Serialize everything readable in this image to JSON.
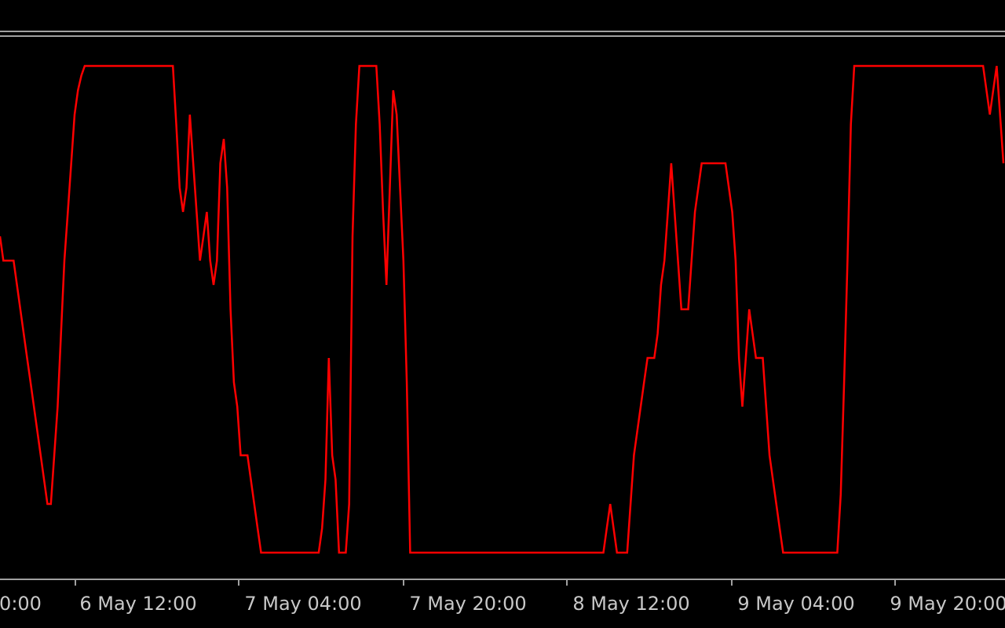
{
  "chart_data": {
    "type": "line",
    "title": "",
    "xlabel": "",
    "ylabel": "",
    "ylim": [
      0,
      100
    ],
    "grid": false,
    "legend": "none",
    "colors": {
      "background": "#000000",
      "series": "#ff0000",
      "frame": "#a0a0a0",
      "text": "#c8c8c8"
    },
    "x_ticks": [
      "0:00",
      "6 May 12:00",
      "7 May 04:00",
      "7 May 20:00",
      "8 May 12:00",
      "9 May 04:00",
      "9 May 20:00"
    ],
    "series": [
      {
        "values": [
          65,
          60,
          60,
          60,
          60,
          55,
          50,
          45,
          40,
          35,
          30,
          25,
          20,
          15,
          10,
          10,
          20,
          30,
          45,
          60,
          70,
          80,
          90,
          95,
          98,
          100,
          100,
          100,
          100,
          100,
          100,
          100,
          100,
          100,
          100,
          100,
          100,
          100,
          100,
          100,
          100,
          100,
          100,
          100,
          100,
          100,
          100,
          100,
          100,
          100,
          100,
          100,
          88,
          75,
          70,
          75,
          90,
          80,
          70,
          60,
          65,
          70,
          60,
          55,
          60,
          80,
          85,
          75,
          50,
          35,
          30,
          20,
          20,
          20,
          15,
          10,
          5,
          0,
          0,
          0,
          0,
          0,
          0,
          0,
          0,
          0,
          0,
          0,
          0,
          0,
          0,
          0,
          0,
          0,
          0,
          5,
          15,
          40,
          20,
          15,
          0,
          0,
          0,
          10,
          65,
          88,
          100,
          100,
          100,
          100,
          100,
          100,
          88,
          70,
          55,
          75,
          95,
          90,
          75,
          60,
          35,
          0,
          0,
          0,
          0,
          0,
          0,
          0,
          0,
          0,
          0,
          0,
          0,
          0,
          0,
          0,
          0,
          0,
          0,
          0,
          0,
          0,
          0,
          0,
          0,
          0,
          0,
          0,
          0,
          0,
          0,
          0,
          0,
          0,
          0,
          0,
          0,
          0,
          0,
          0,
          0,
          0,
          0,
          0,
          0,
          0,
          0,
          0,
          0,
          0,
          0,
          0,
          0,
          0,
          0,
          0,
          0,
          0,
          0,
          5,
          10,
          5,
          0,
          0,
          0,
          0,
          10,
          20,
          25,
          30,
          35,
          40,
          40,
          40,
          45,
          55,
          60,
          70,
          80,
          70,
          60,
          50,
          50,
          50,
          60,
          70,
          75,
          80,
          80,
          80,
          80,
          80,
          80,
          80,
          80,
          75,
          70,
          60,
          40,
          30,
          40,
          50,
          45,
          40,
          40,
          40,
          30,
          20,
          15,
          10,
          5,
          0,
          0,
          0,
          0,
          0,
          0,
          0,
          0,
          0,
          0,
          0,
          0,
          0,
          0,
          0,
          0,
          0,
          12,
          35,
          60,
          88,
          100,
          100,
          100,
          100,
          100,
          100,
          100,
          100,
          100,
          100,
          100,
          100,
          100,
          100,
          100,
          100,
          100,
          100,
          100,
          100,
          100,
          100,
          100,
          100,
          100,
          100,
          100,
          100,
          100,
          100,
          100,
          100,
          100,
          100,
          100,
          100,
          100,
          100,
          100,
          95,
          90,
          95,
          100,
          90,
          80
        ]
      }
    ]
  }
}
